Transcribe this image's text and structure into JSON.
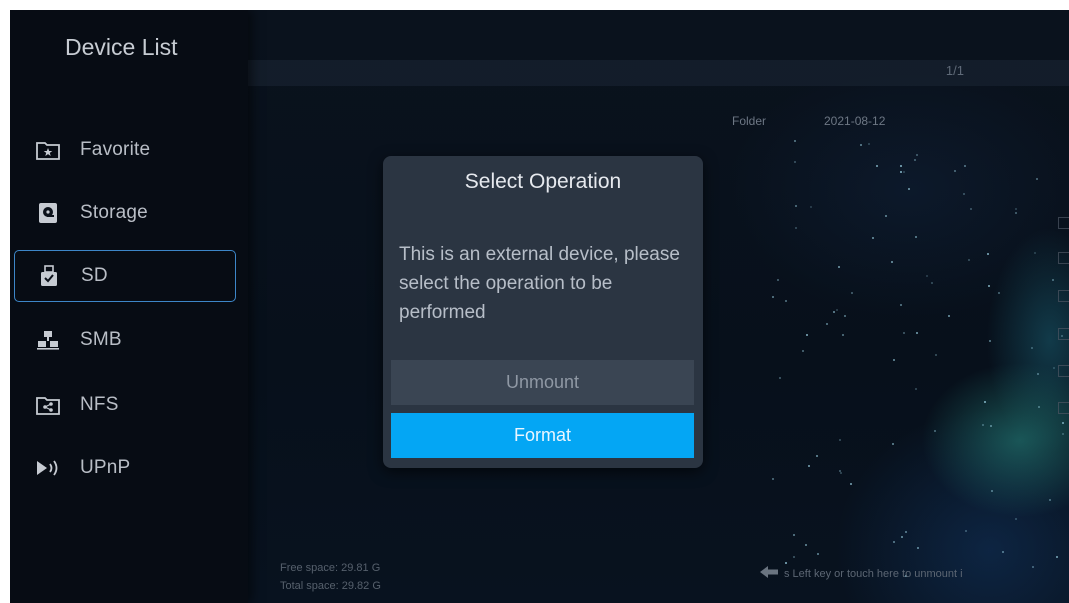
{
  "sidebar": {
    "title": "Device List",
    "items": [
      {
        "label": "Favorite",
        "icon": "favorite-folder-icon"
      },
      {
        "label": "Storage",
        "icon": "storage-icon"
      },
      {
        "label": "SD",
        "icon": "sd-card-icon"
      },
      {
        "label": "SMB",
        "icon": "smb-network-icon"
      },
      {
        "label": "NFS",
        "icon": "nfs-share-icon"
      },
      {
        "label": "UPnP",
        "icon": "upnp-cast-icon"
      }
    ],
    "selected": "SD"
  },
  "file_browser": {
    "page_indicator": "1/1",
    "type_value": "Folder",
    "date_value": "2021-08-12"
  },
  "footer": {
    "free_space": "Free space: 29.81 G",
    "total_space": "Total space: 29.82 G",
    "hint": "s Left key or touch here to unmount i"
  },
  "dialog": {
    "title": "Select Operation",
    "message": "This is an external device, please select the operation to be performed",
    "unmount_label": "Unmount",
    "format_label": "Format"
  },
  "colors": {
    "accent": "#04a6f4",
    "selection_border": "#3d86c8",
    "dialog_bg": "#2b3542"
  }
}
